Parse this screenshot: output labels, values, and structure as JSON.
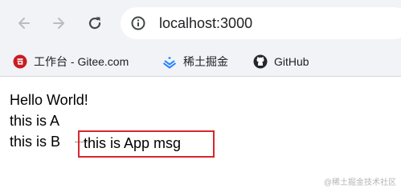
{
  "toolbar": {
    "back_icon": "arrow-left-icon",
    "forward_icon": "arrow-right-icon",
    "reload_icon": "reload-icon",
    "site_info_icon": "info-circle-icon",
    "url": "localhost:3000"
  },
  "bookmarks": [
    {
      "label": "工作台 - Gitee.com",
      "icon": "gitee-icon",
      "color": "#c71d23"
    },
    {
      "label": "稀土掘金",
      "icon": "juejin-icon",
      "color": "#1e80ff"
    },
    {
      "label": "GitHub",
      "icon": "github-icon",
      "color": "#24292f"
    }
  ],
  "page": {
    "line1": "Hello World!",
    "line2": "this is A",
    "line3_prefix": "this is B",
    "app_msg": "this is App msg"
  },
  "highlight_color": "#d9262c",
  "watermark": "@稀土掘金技术社区"
}
